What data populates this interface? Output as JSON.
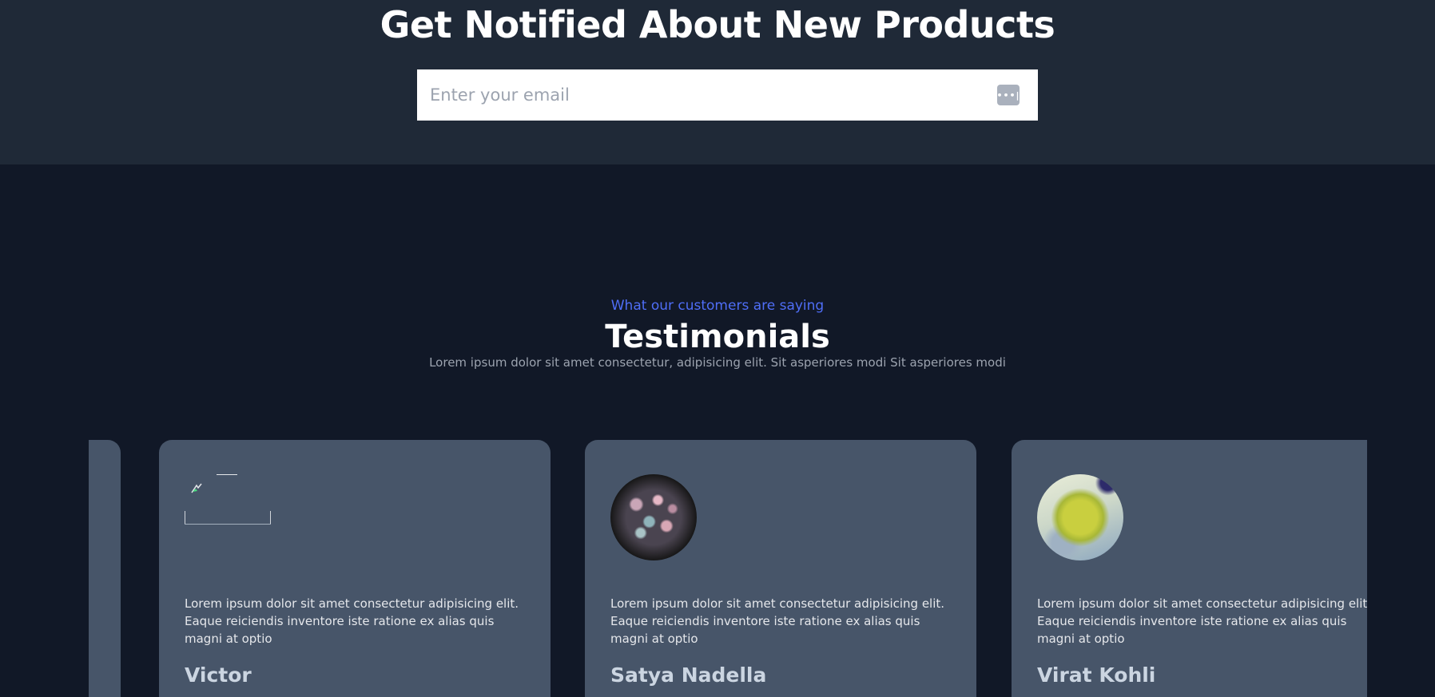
{
  "newsletter": {
    "heading": "Get Notified About New Products",
    "email_placeholder": "Enter your email",
    "email_value": "",
    "icon": "password-manager-key-icon"
  },
  "testimonials": {
    "eyebrow": "What our customers are saying",
    "title": "Testimonials",
    "subtitle": "Lorem ipsum dolor sit amet consectetur, adipisicing elit. Sit asperiores modi Sit asperiores modi",
    "cards": [
      {
        "name": "Victor",
        "quote": "Lorem ipsum dolor sit amet consectetur adipisicing elit. Eaque reiciendis inventore iste ratione ex alias quis magni at optio",
        "avatar": "broken-image"
      },
      {
        "name": "Satya Nadella",
        "quote": "Lorem ipsum dolor sit amet consectetur adipisicing elit. Eaque reiciendis inventore iste ratione ex alias quis magni at optio",
        "avatar": "flowers-photo"
      },
      {
        "name": "Virat Kohli",
        "quote": "Lorem ipsum dolor sit amet consectetur adipisicing elit. Eaque reiciendis inventore iste ratione ex alias quis magni at optio",
        "avatar": "leaf-photo"
      }
    ]
  },
  "colors": {
    "page_bg": "#111827",
    "newsletter_bg": "#1f2937",
    "card_bg": "#475569",
    "accent": "#4f6ef7"
  }
}
